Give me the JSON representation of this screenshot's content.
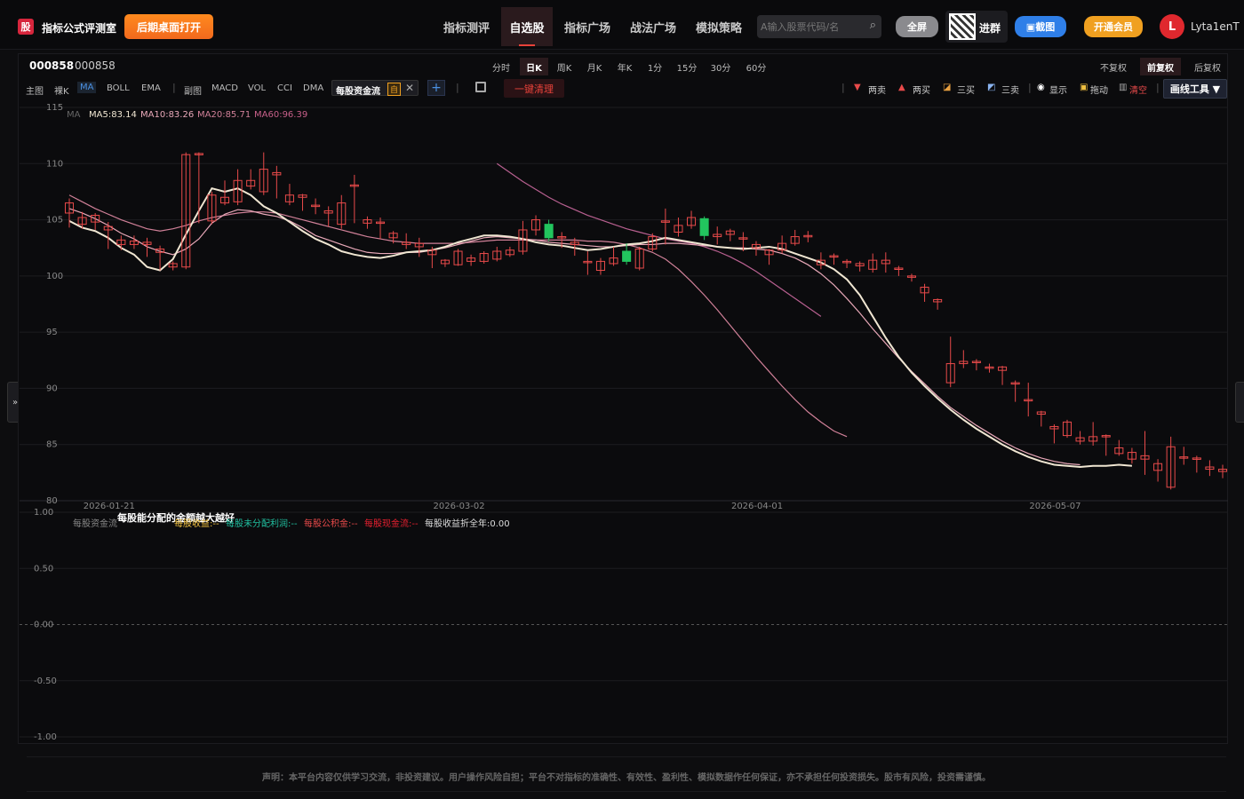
{
  "header": {
    "logo": "股",
    "title": "指标公式评测室",
    "desktop_button": "后期桌面打开",
    "nav": [
      "指标测评",
      "自选股",
      "指标广场",
      "战法广场",
      "模拟策略"
    ],
    "nav_active": 1,
    "search_placeholder": "A输入股票代码/名",
    "fullscreen": "全屏",
    "join_group": "进群",
    "screenshot": "截图",
    "vip": "开通会员",
    "avatar_letter": "L",
    "username": "Lyta1enT"
  },
  "toolbar": {
    "code": "000858",
    "name": "000858",
    "periods": [
      "分时",
      "日K",
      "周K",
      "月K",
      "年K",
      "1分",
      "15分",
      "30分",
      "60分"
    ],
    "period_active": 1,
    "adjust": [
      "不复权",
      "前复权",
      "后复权"
    ],
    "adjust_active": 1,
    "indicators_main": [
      "主图",
      "裸K",
      "MA",
      "BOLL",
      "EMA"
    ],
    "indicators_sub": [
      "副图",
      "MACD",
      "VOL",
      "CCI",
      "DMA"
    ],
    "custom_tag": "每股资金流",
    "custom_tag_badge": "自",
    "clear_all": "一键清理",
    "tools": [
      "两卖",
      "两买",
      "三买",
      "三卖",
      "显示",
      "拖动",
      "清空"
    ],
    "draw_tools": "画线工具 ▼"
  },
  "main_chart": {
    "ma_legend": {
      "label": "MA",
      "ma5": "MA5:83.14",
      "ma10": "MA10:83.26",
      "ma20": "MA20:85.71",
      "ma60": "MA60:96.39"
    },
    "y_ticks": [
      "115",
      "110",
      "105",
      "100",
      "95",
      "90",
      "85",
      "80"
    ],
    "x_ticks": [
      "2026-01-21",
      "2026-03-02",
      "2026-04-01",
      "2026-05-07"
    ],
    "colors": {
      "up": "#e84a4a",
      "down": "#22c55e",
      "ma5": "#f0e6d2",
      "ma10": "#e8a8b8",
      "ma20": "#d08098",
      "ma60": "#b86090"
    }
  },
  "sub_chart": {
    "legend": [
      "每股资金流",
      "每股能分配的金额越大越好",
      "每股收益:--",
      "每股未分配利润:--",
      "每股公积金:--",
      "每股现金流:--",
      "每股收益折全年:0.00"
    ],
    "y_ticks": [
      "1.00",
      "0.50",
      "0.00",
      "-0.50",
      "-1.00"
    ]
  },
  "side_toggle": "»",
  "footer": "声明：本平台内容仅供学习交流，非投资建议。用户操作风险自担；平台不对指标的准确性、有效性、盈利性、模拟数据作任何保证，亦不承担任何投资损失。股市有风险，投资需谨慎。",
  "chart_data": {
    "type": "candlestick",
    "y_range": [
      80,
      115
    ],
    "candles": [
      [
        105.6,
        106.5,
        104.6,
        104.3,
        106.9
      ],
      [
        104.6,
        105.2,
        104.4,
        104.2,
        105.7
      ],
      [
        104.8,
        105.4,
        104.5,
        104.1,
        105.6
      ],
      [
        104.1,
        104.4,
        102.6,
        102.4,
        104.8
      ],
      [
        102.8,
        103.2,
        102.7,
        102.3,
        103.6
      ],
      [
        102.8,
        103.1,
        102.5,
        102.4,
        103.6
      ],
      [
        102.8,
        103.0,
        101.9,
        101.7,
        103.4
      ],
      [
        102.1,
        102.4,
        100.8,
        100.5,
        102.7
      ],
      [
        100.8,
        101.1,
        100.8,
        100.5,
        101.3
      ],
      [
        100.8,
        110.8,
        100.8,
        100.6,
        111.0
      ],
      [
        110.8,
        110.9,
        104.9,
        104.7,
        111.0
      ],
      [
        104.9,
        107.2,
        104.9,
        104.6,
        107.5
      ],
      [
        106.5,
        107.0,
        106.5,
        106.3,
        108.5
      ],
      [
        106.6,
        108.5,
        106.6,
        106.3,
        109.5
      ],
      [
        108.0,
        108.5,
        107.9,
        107.7,
        109.5
      ],
      [
        107.5,
        109.5,
        107.4,
        107.2,
        111.0
      ],
      [
        109.0,
        109.2,
        107.1,
        106.9,
        109.8
      ],
      [
        106.6,
        107.2,
        106.6,
        106.3,
        108.2
      ],
      [
        107.0,
        107.2,
        106.0,
        105.8,
        107.3
      ],
      [
        106.2,
        106.3,
        105.8,
        105.5,
        106.9
      ],
      [
        105.6,
        105.8,
        104.6,
        104.4,
        106.2
      ],
      [
        104.6,
        106.5,
        104.6,
        104.2,
        107.2
      ],
      [
        108.0,
        108.1,
        105.0,
        104.7,
        109.0
      ],
      [
        104.7,
        105.0,
        104.7,
        104.2,
        105.3
      ],
      [
        104.7,
        104.8,
        103.4,
        103.3,
        105.2
      ],
      [
        103.4,
        103.8,
        103.2,
        102.9,
        104.0
      ],
      [
        102.8,
        103.0,
        102.6,
        102.4,
        103.8
      ],
      [
        102.6,
        102.9,
        101.9,
        101.7,
        103.4
      ],
      [
        101.9,
        102.3,
        100.9,
        100.7,
        102.6
      ],
      [
        101.1,
        101.4,
        101.0,
        100.8,
        101.5
      ],
      [
        101.0,
        102.2,
        101.0,
        100.9,
        102.4
      ],
      [
        101.3,
        101.6,
        101.1,
        100.9,
        101.9
      ],
      [
        101.3,
        102.0,
        101.3,
        101.1,
        102.2
      ],
      [
        101.5,
        102.2,
        101.5,
        101.3,
        102.6
      ],
      [
        101.9,
        102.3,
        101.9,
        101.7,
        102.6
      ],
      [
        102.2,
        104.1,
        102.2,
        101.9,
        104.9
      ],
      [
        104.1,
        105.0,
        104.1,
        103.6,
        105.4
      ],
      [
        104.6,
        103.4,
        103.4,
        103.1,
        105.0
      ],
      [
        103.4,
        103.5,
        102.7,
        102.5,
        103.9
      ],
      [
        102.8,
        103.0,
        102.0,
        101.8,
        103.4
      ],
      [
        101.2,
        101.3,
        100.3,
        100.1,
        102.2
      ],
      [
        100.5,
        101.3,
        100.5,
        100.1,
        101.6
      ],
      [
        101.1,
        101.6,
        101.1,
        100.9,
        102.6
      ],
      [
        102.2,
        101.3,
        101.3,
        101.0,
        102.9
      ],
      [
        100.7,
        102.4,
        100.7,
        100.5,
        102.6
      ],
      [
        102.4,
        103.5,
        102.4,
        102.2,
        103.8
      ],
      [
        104.8,
        104.9,
        103.0,
        102.8,
        106.0
      ],
      [
        103.9,
        104.5,
        103.9,
        103.5,
        105.2
      ],
      [
        104.5,
        105.2,
        104.5,
        104.2,
        105.8
      ],
      [
        105.1,
        103.6,
        103.5,
        103.2,
        105.3
      ],
      [
        103.5,
        103.7,
        103.1,
        102.8,
        104.4
      ],
      [
        103.7,
        104.0,
        103.3,
        103.1,
        104.2
      ],
      [
        103.3,
        103.4,
        102.5,
        102.2,
        103.9
      ],
      [
        102.5,
        102.8,
        101.9,
        101.8,
        103.1
      ],
      [
        101.9,
        102.3,
        101.6,
        101.0,
        102.4
      ],
      [
        102.3,
        102.9,
        102.3,
        102.0,
        103.6
      ],
      [
        102.9,
        103.5,
        102.9,
        102.7,
        104.1
      ],
      [
        103.5,
        103.6,
        103.2,
        103.0,
        104.0
      ],
      [
        101.0,
        101.4,
        101.0,
        100.6,
        102.1
      ],
      [
        101.7,
        101.8,
        101.2,
        101.0,
        102.0
      ],
      [
        101.2,
        101.3,
        100.9,
        100.7,
        101.5
      ],
      [
        100.9,
        101.1,
        100.6,
        100.4,
        101.3
      ],
      [
        100.6,
        101.4,
        100.6,
        100.3,
        102.0
      ],
      [
        101.1,
        101.4,
        100.6,
        100.3,
        102.1
      ],
      [
        100.6,
        100.7,
        100.2,
        100.0,
        100.9
      ],
      [
        99.9,
        100.0,
        99.7,
        99.5,
        100.2
      ],
      [
        98.5,
        99.0,
        98.5,
        97.7,
        99.3
      ],
      [
        97.7,
        97.9,
        97.1,
        97.0,
        98.0
      ],
      [
        90.5,
        92.2,
        90.5,
        90.1,
        94.6
      ],
      [
        92.2,
        92.4,
        92.2,
        91.8,
        93.4
      ],
      [
        92.4,
        92.4,
        91.9,
        91.6,
        92.6
      ],
      [
        91.8,
        91.9,
        91.6,
        91.4,
        92.2
      ],
      [
        91.6,
        91.9,
        90.5,
        90.3,
        92.0
      ],
      [
        90.5,
        90.5,
        89.1,
        88.8,
        90.7
      ],
      [
        88.9,
        89.0,
        88.9,
        87.5,
        90.5
      ],
      [
        87.7,
        87.9,
        86.8,
        86.6,
        88.0
      ],
      [
        86.4,
        86.6,
        85.2,
        85.1,
        86.8
      ],
      [
        85.8,
        87.0,
        85.8,
        85.6,
        87.2
      ],
      [
        85.3,
        85.6,
        85.3,
        85.0,
        86.2
      ],
      [
        85.3,
        85.7,
        85.1,
        84.9,
        87.0
      ],
      [
        85.7,
        85.8,
        84.2,
        84.0,
        85.9
      ],
      [
        84.2,
        84.7,
        84.2,
        84.0,
        85.4
      ],
      [
        83.7,
        84.3,
        83.7,
        83.3,
        84.7
      ],
      [
        83.7,
        84.0,
        82.7,
        82.3,
        86.2
      ],
      [
        82.7,
        83.3,
        81.9,
        81.7,
        83.7
      ],
      [
        81.2,
        84.8,
        81.2,
        81.0,
        85.7
      ],
      [
        83.9,
        83.9,
        83.4,
        83.2,
        84.8
      ],
      [
        83.7,
        83.8,
        83.0,
        82.5,
        84.0
      ],
      [
        82.8,
        83.0,
        82.7,
        82.2,
        83.6
      ],
      [
        82.6,
        82.8,
        82.5,
        82.0,
        83.2
      ]
    ],
    "ma5": [
      104.9,
      104.3,
      104.0,
      103.4,
      102.5,
      101.9,
      100.8,
      100.5,
      101.5,
      103.7,
      105.8,
      107.8,
      107.5,
      107.8,
      107.2,
      106.2,
      105.6,
      104.8,
      104.0,
      103.3,
      102.8,
      102.2,
      101.9,
      101.7,
      101.6,
      101.8,
      102.1,
      102.2,
      102.3,
      102.6,
      103.0,
      103.3,
      103.6,
      103.6,
      103.5,
      103.3,
      103.0,
      102.8,
      102.7,
      102.5,
      102.3,
      102.4,
      102.6,
      102.8,
      102.9,
      103.1,
      103.4,
      103.2,
      103.0,
      102.8,
      102.6,
      102.5,
      102.4,
      102.5,
      102.6,
      102.4,
      102.0,
      101.6,
      101.2,
      100.6,
      99.7,
      98.3,
      96.4,
      94.5,
      92.8,
      91.4,
      90.2,
      89.1,
      88.1,
      87.2,
      86.4,
      85.7,
      85.0,
      84.4,
      83.9,
      83.5,
      83.2,
      83.1,
      83.0,
      83.1,
      83.1,
      83.2,
      83.1
    ],
    "ma10": [
      106.0,
      105.6,
      105.1,
      104.5,
      103.8,
      103.3,
      102.6,
      102.2,
      101.9,
      102.4,
      103.3,
      104.7,
      105.5,
      105.9,
      105.8,
      105.5,
      105.3,
      104.9,
      104.3,
      103.6,
      103.2,
      102.8,
      102.4,
      102.1,
      102.0,
      102.0,
      102.1,
      102.1,
      102.3,
      102.5,
      102.8,
      103.1,
      103.4,
      103.5,
      103.4,
      103.3,
      103.2,
      103.0,
      102.9,
      102.8,
      102.7,
      102.6,
      102.6,
      102.7,
      102.8,
      102.8,
      102.9,
      102.9,
      102.8,
      102.7,
      102.6,
      102.5,
      102.5,
      102.4,
      102.3,
      102.0,
      101.6,
      101.0,
      100.2,
      99.2,
      98.0,
      96.7,
      95.3,
      94.0,
      92.7,
      91.5,
      90.4,
      89.3,
      88.3,
      87.5,
      86.7,
      86.0,
      85.3,
      84.7,
      84.2,
      83.8,
      83.5,
      83.3,
      83.2
    ],
    "ma20": [
      107.2,
      106.6,
      106.0,
      105.5,
      105.0,
      104.6,
      104.2,
      104.0,
      104.2,
      104.5,
      104.9,
      105.2,
      105.4,
      105.6,
      105.7,
      105.7,
      105.6,
      105.3,
      105.0,
      104.7,
      104.4,
      104.1,
      103.8,
      103.5,
      103.3,
      103.1,
      103.0,
      102.9,
      102.9,
      102.9,
      102.9,
      103.0,
      103.1,
      103.2,
      103.2,
      103.2,
      103.2,
      103.2,
      103.2,
      103.2,
      103.1,
      103.1,
      103.0,
      102.8,
      102.5,
      102.1,
      101.5,
      100.6,
      99.5,
      98.3,
      97.0,
      95.6,
      94.2,
      92.8,
      91.5,
      90.2,
      89.0,
      87.9,
      87.0,
      86.2,
      85.7
    ],
    "ma60": [
      110.0,
      109.2,
      108.4,
      107.7,
      107.0,
      106.4,
      105.9,
      105.4,
      105.0,
      104.6,
      104.2,
      103.9,
      103.6,
      103.3,
      103.1,
      102.9,
      102.6,
      102.2,
      101.7,
      101.1,
      100.4,
      99.6,
      98.8,
      98.0,
      97.2,
      96.4
    ]
  }
}
